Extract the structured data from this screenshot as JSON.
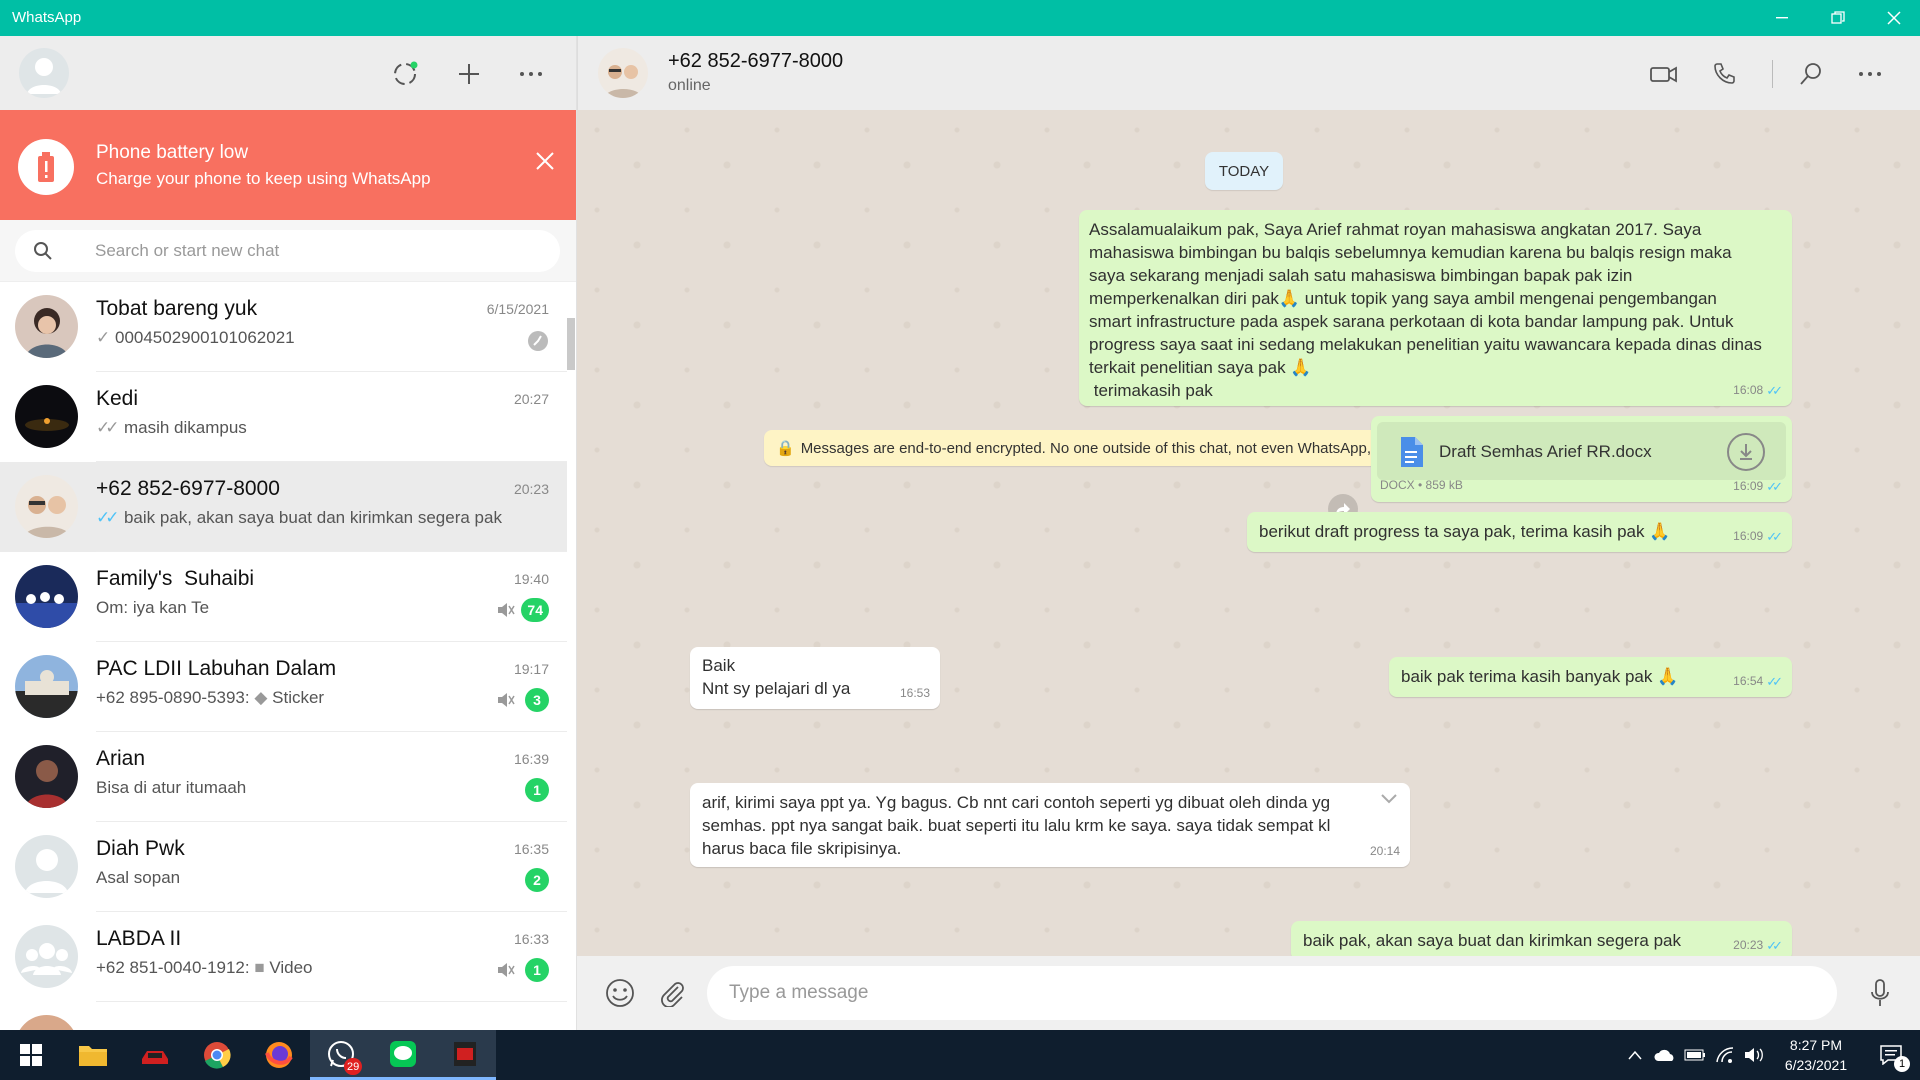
{
  "window": {
    "title": "WhatsApp"
  },
  "banner": {
    "title": "Phone battery low",
    "subtitle": "Charge your phone to keep using WhatsApp"
  },
  "search": {
    "placeholder": "Search or start new chat"
  },
  "chats": [
    {
      "name": "Tobat bareng yuk",
      "time": "6/15/2021",
      "preview": "0004502900101062021",
      "tick": "✓",
      "tick_color": "#999999"
    },
    {
      "name": "Kedi",
      "time": "20:27",
      "preview": "masih dikampus",
      "tick": "✓✓",
      "tick_color": "#999999"
    },
    {
      "name": "+62 852-6977-8000",
      "time": "20:23",
      "preview": "baik pak, akan saya buat dan kirimkan segera pak",
      "tick": "✓✓",
      "tick_color": "#4fc3f7"
    },
    {
      "name": "Family's  Suhaibi",
      "time": "19:40",
      "preview": "Om: iya kan Te",
      "badge": "74"
    },
    {
      "name": "PAC LDII Labuhan Dalam",
      "time": "19:17",
      "preview_prefix": "+62 895-0890-5393: ",
      "preview": "Sticker",
      "badge": "3"
    },
    {
      "name": "Arian",
      "time": "16:39",
      "preview": "Bisa di atur itumaah",
      "badge": "1"
    },
    {
      "name": "Diah Pwk",
      "time": "16:35",
      "preview": "Asal sopan",
      "badge": "2"
    },
    {
      "name": "LABDA II",
      "time": "16:33",
      "preview_prefix": "+62 851-0040-1912: ",
      "preview": "Video",
      "badge": "1"
    }
  ],
  "conversation": {
    "contact": "+62 852-6977-8000",
    "status": "online",
    "date_label": "TODAY",
    "encryption_notice": "Messages are end-to-end encrypted. No one outside of this chat, not even WhatsApp, can read or listen to them. Click to learn more.",
    "messages": [
      {
        "dir": "out",
        "text": "Assalamualaikum pak, Saya Arief rahmat royan mahasiswa angkatan 2017. Saya\nmahasiswa bimbingan bu balqis sebelumnya kemudian karena bu balqis resign maka\nsaya sekarang menjadi salah satu mahasiswa bimbingan bapak pak izin\nmemperkenalkan diri pak🙏 untuk topik yang saya ambil mengenai pengembangan\nsmart infrastructure pada aspek sarana perkotaan di kota bandar lampung pak. Untuk\nprogress saya saat ini sedang melakukan penelitian yaitu wawancara kepada dinas dinas\nterkait penelitian saya pak 🙏\n terimakasih pak",
        "time": "16:08"
      },
      {
        "dir": "out",
        "type": "doc",
        "filename": "Draft Semhas Arief RR.docx",
        "docinfo": "DOCX • 859 kB",
        "time": "16:09"
      },
      {
        "dir": "out",
        "text": "berikut draft progress ta saya pak, terima kasih pak 🙏",
        "time": "16:09"
      },
      {
        "dir": "in",
        "text": "Baik\nNnt sy pelajari dl ya",
        "time": "16:53"
      },
      {
        "dir": "out",
        "text": "baik pak terima kasih banyak pak 🙏",
        "time": "16:54"
      },
      {
        "dir": "in",
        "text": "arif, kirimi saya ppt ya. Yg bagus. Cb nnt cari contoh seperti yg dibuat oleh dinda yg\nsemhas. ppt nya sangat baik. buat seperti itu lalu krm ke saya. saya tidak sempat kl\nharus baca file skripisinya.",
        "time": "20:14"
      },
      {
        "dir": "out",
        "text": "baik pak, akan saya buat dan kirimkan segera pak",
        "time": "20:23"
      }
    ],
    "compose_placeholder": "Type a message"
  },
  "taskbar": {
    "whatsapp_badge": "29",
    "time": "8:27 PM",
    "date": "6/23/2021",
    "notification_count": "1"
  },
  "colors": {
    "accent": "#00bfa5",
    "banner": "#f87060",
    "outgoing": "#dcf8c6",
    "badge": "#25d366",
    "read_ticks": "#4fc3f7"
  }
}
